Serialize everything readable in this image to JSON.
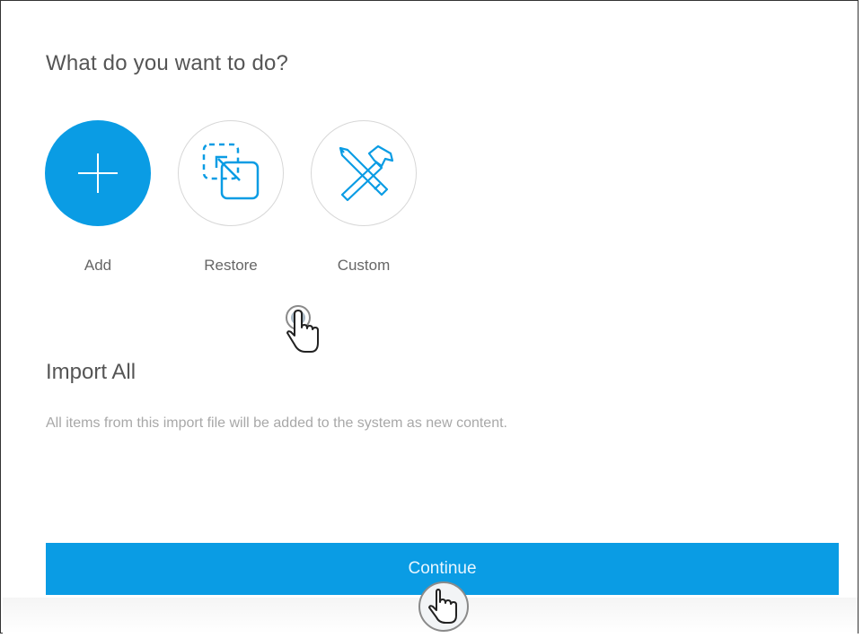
{
  "dialog": {
    "question": "What do you want to do?",
    "options": [
      {
        "label": "Add",
        "icon": "plus-icon",
        "selected": true
      },
      {
        "label": "Restore",
        "icon": "restore-icon",
        "selected": false
      },
      {
        "label": "Custom",
        "icon": "tools-icon",
        "selected": false
      }
    ],
    "section_title": "Import All",
    "section_description": "All items from this import file will be added to the system as new content.",
    "continue_label": "Continue"
  },
  "colors": {
    "accent": "#0a9ce4",
    "heading": "#555555",
    "muted": "#a8a8a8"
  }
}
